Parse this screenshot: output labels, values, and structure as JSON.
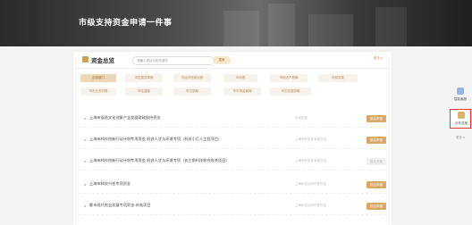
{
  "banner": {
    "title": "市级支持资金申请一件事"
  },
  "header": {
    "title": "资金总览",
    "search_placeholder": "请输入项目名称关键字",
    "search_button": "搜索",
    "right_link": "更多 ▸"
  },
  "categories": [
    {
      "label": "全部部门",
      "active": true
    },
    {
      "label": "市发展改革委",
      "active": false
    },
    {
      "label": "市经济信息化委",
      "active": false
    },
    {
      "label": "市科委",
      "active": false
    },
    {
      "label": "市知识产权局",
      "active": false
    },
    {
      "label": "市商务委",
      "active": false
    },
    {
      "label": "市农业农村委",
      "active": false
    },
    {
      "label": "市住建委",
      "active": false
    },
    {
      "label": "市文旅局",
      "active": false
    },
    {
      "label": "市市场监管局",
      "active": false
    },
    {
      "label": "市文化旅游局",
      "active": false
    }
  ],
  "rows": [
    {
      "name": "上海市促进文化创意产业发展财政扶持资金",
      "dept": "市宣传部",
      "action": "前往申报",
      "enabled": true
    },
    {
      "name": "上海市科技创新行动计划专项资金-科技人才与环境专项（科技小巨人工程项目）",
      "dept": "上海市科学技术委员会",
      "action": "前往申报",
      "enabled": true
    },
    {
      "name": "上海市科技创新行动计划专项资金-科技人才与环境专项（长三角科技联合攻关项目）",
      "dept": "上海市科学技术委员会",
      "action": "暂未开放",
      "enabled": false
    },
    {
      "name": "上海市科技兴农专项资金",
      "dept": "上海市农业农村委员会",
      "action": "前往申报",
      "enabled": true
    },
    {
      "name": "都市现代农业发展专项资金-补贴项目",
      "dept": "上海市农业农村委员会",
      "action": "前往申报",
      "enabled": true
    }
  ],
  "side": {
    "items": [
      {
        "label": "智能客服"
      },
      {
        "label": "办件进度"
      }
    ],
    "more": "更多 ▾"
  },
  "colors": {
    "accent": "#d9a866",
    "highlight": "#e33333"
  }
}
